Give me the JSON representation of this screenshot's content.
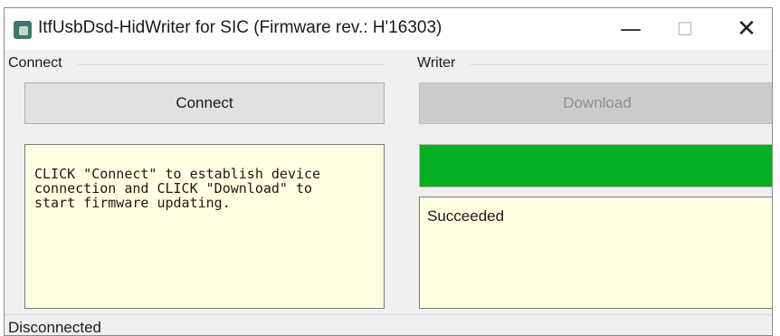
{
  "window": {
    "title": "ItfUsbDsd-HidWriter for SIC (Firmware rev.: H'16303)",
    "icon": "app-icon",
    "controls": {
      "minimize": "—",
      "maximize": "☐",
      "close": "✕"
    }
  },
  "connect_group": {
    "label": "Connect",
    "button_label": "Connect",
    "info_text": "CLICK \"Connect\" to establish device\nconnection and CLICK \"Download\" to\nstart firmware updating."
  },
  "writer_group": {
    "label": "Writer",
    "button_label": "Download",
    "button_enabled": false,
    "progress_fraction": 1.0,
    "progress_color": "#06b025",
    "result_text": "Succeeded"
  },
  "status_bar": {
    "text": "Disconnected"
  }
}
